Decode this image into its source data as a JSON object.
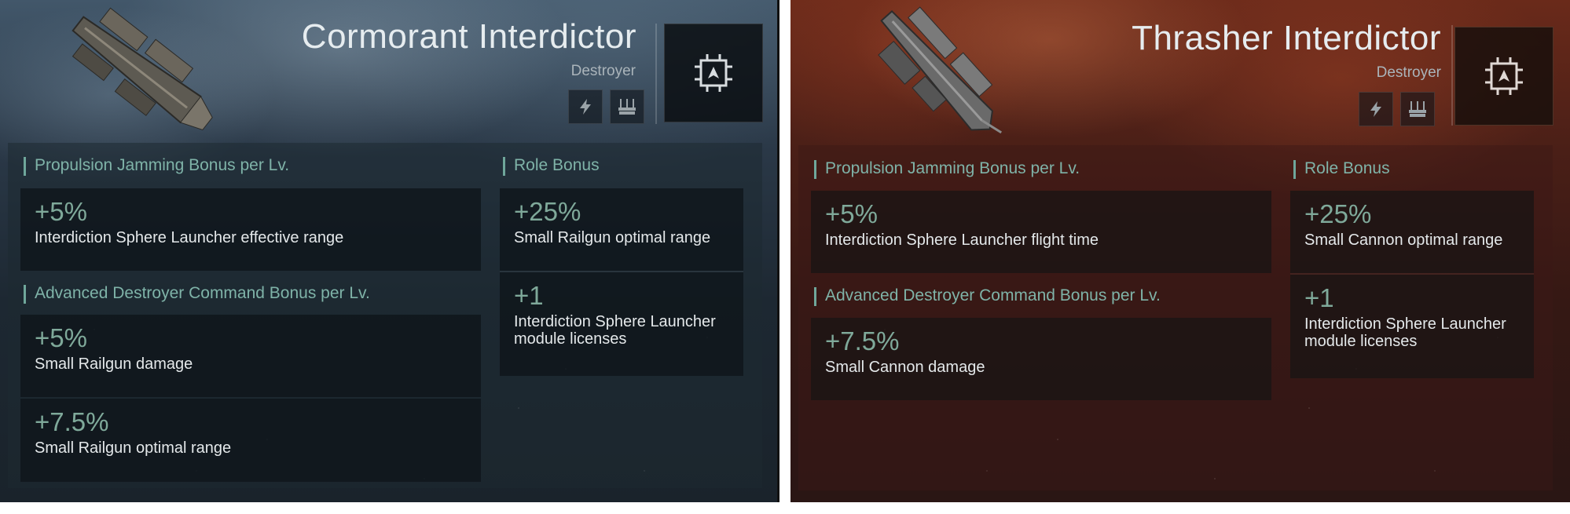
{
  "left": {
    "title": "Cormorant Interdictor",
    "ship_class": "Destroyer",
    "icons": [
      "lightning-icon",
      "turret-icon"
    ],
    "sections": {
      "propulsion": {
        "header": "Propulsion Jamming Bonus per Lv.",
        "bonuses": [
          {
            "value": "+5%",
            "text": "Interdiction Sphere Launcher effective range"
          }
        ]
      },
      "advanced": {
        "header": "Advanced Destroyer Command Bonus per Lv.",
        "bonuses": [
          {
            "value": "+5%",
            "text": "Small Railgun damage"
          },
          {
            "value": "+7.5%",
            "text": "Small Railgun optimal range"
          }
        ]
      },
      "role": {
        "header": "Role Bonus",
        "bonuses": [
          {
            "value": "+25%",
            "text": "Small Railgun optimal range"
          },
          {
            "value": "+1",
            "text": "Interdiction Sphere Launcher module licenses"
          }
        ]
      }
    }
  },
  "right": {
    "title": "Thrasher Interdictor",
    "ship_class": "Destroyer",
    "icons": [
      "lightning-icon",
      "turret-icon"
    ],
    "sections": {
      "propulsion": {
        "header": "Propulsion Jamming Bonus per Lv.",
        "bonuses": [
          {
            "value": "+5%",
            "text": "Interdiction Sphere Launcher flight time"
          }
        ]
      },
      "advanced": {
        "header": "Advanced Destroyer Command Bonus per Lv.",
        "bonuses": [
          {
            "value": "+7.5%",
            "text": "Small Cannon damage"
          }
        ]
      },
      "role": {
        "header": "Role Bonus",
        "bonuses": [
          {
            "value": "+25%",
            "text": "Small Cannon optimal range"
          },
          {
            "value": "+1",
            "text": "Interdiction Sphere Launcher module licenses"
          }
        ]
      }
    }
  },
  "colors": {
    "accent": "#7fb3a8",
    "bonus_value": "#7fa99a",
    "text": "#e4e8ea",
    "left_bg": "#2a3847",
    "right_bg": "#4a1f17"
  }
}
